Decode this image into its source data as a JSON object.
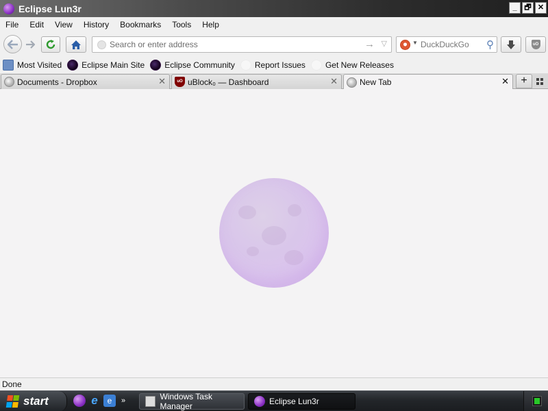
{
  "window": {
    "title": "Eclipse Lun3r",
    "controls": {
      "minimize": "_",
      "restore": "🗗",
      "close": "✕"
    }
  },
  "menu": [
    "File",
    "Edit",
    "View",
    "History",
    "Bookmarks",
    "Tools",
    "Help"
  ],
  "nav": {
    "url_placeholder": "Search or enter address",
    "url_value": "",
    "search_placeholder": "DuckDuckGo",
    "go_arrow": "→"
  },
  "bookmarks": [
    {
      "label": "Most Visited",
      "icon": "most-visited-icon"
    },
    {
      "label": "Eclipse Main Site",
      "icon": "eclipse-icon"
    },
    {
      "label": "Eclipse Community",
      "icon": "eclipse-icon"
    },
    {
      "label": "Report Issues",
      "icon": "blank-page-icon"
    },
    {
      "label": "Get New Releases",
      "icon": "blank-page-icon"
    }
  ],
  "tabs": [
    {
      "label": "Documents - Dropbox",
      "icon": "globe-icon",
      "active": false
    },
    {
      "label": "uBlock₀ — Dashboard",
      "icon": "ublock-icon",
      "active": false
    },
    {
      "label": "New Tab",
      "icon": "globe-icon",
      "active": true
    }
  ],
  "tab_controls": {
    "close": "✕",
    "new_tab": "+"
  },
  "status": {
    "text": "Done"
  },
  "taskbar": {
    "start_label": "start",
    "quick_launch_more": "»",
    "tasks": [
      {
        "label": "Windows Task Manager",
        "active": false
      },
      {
        "label": "Eclipse Lun3r",
        "active": true
      }
    ]
  },
  "colors": {
    "accent_purple": "#8a2fc4",
    "moon": "#dcc6ec",
    "taskbar": "#23262a"
  }
}
